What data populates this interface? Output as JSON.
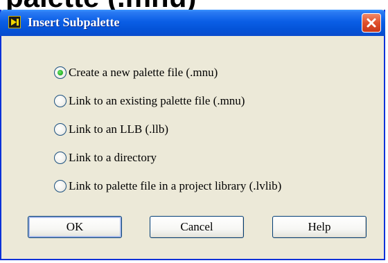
{
  "header_fragment": "paiette (.mnu)",
  "window": {
    "title": "Insert Subpalette",
    "icon": "labview-icon",
    "close_icon": "close-icon"
  },
  "options": [
    {
      "label": "Create a new palette file (.mnu)",
      "checked": true
    },
    {
      "label": "Link to an existing palette file (.mnu)",
      "checked": false
    },
    {
      "label": "Link to an LLB (.llb)",
      "checked": false
    },
    {
      "label": "Link to a directory",
      "checked": false
    },
    {
      "label": "Link to palette file in a project library (.lvlib)",
      "checked": false
    }
  ],
  "buttons": {
    "ok": "OK",
    "cancel": "Cancel",
    "help": "Help"
  },
  "colors": {
    "titlebar": "#0453d8",
    "dialog_bg": "#ece9d8",
    "close": "#e0502c",
    "radio_selected": "#2ab52a"
  }
}
